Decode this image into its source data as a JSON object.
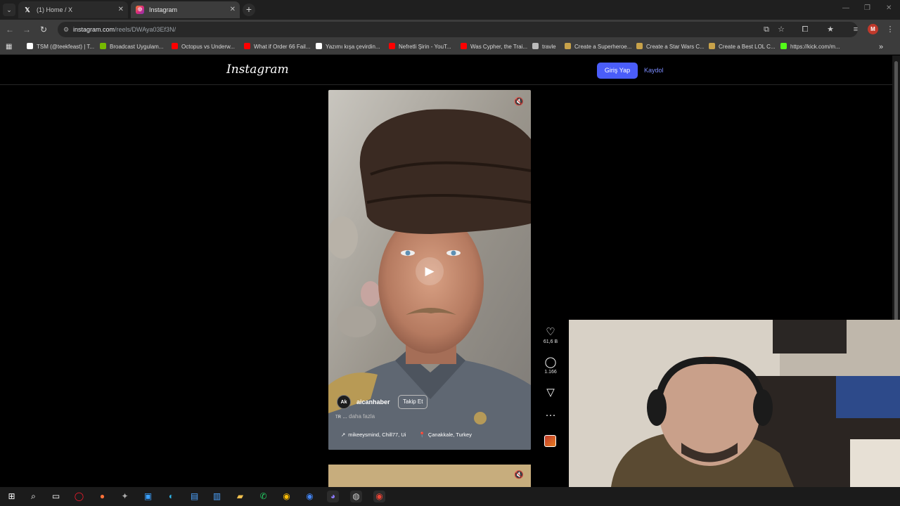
{
  "browser": {
    "tabs": [
      {
        "title": "(1) Home / X",
        "icon": "x-logo-icon",
        "active": false
      },
      {
        "title": "Instagram",
        "icon": "instagram-icon",
        "active": true
      }
    ],
    "url_host": "instagram.com",
    "url_path": "/reels/DWAya03Ef3N/",
    "profile_initial": "M",
    "bookmarks": [
      {
        "label": "TSM (@teekfeast) | T...",
        "icon": "tiktok-icon",
        "color": "#ffffff"
      },
      {
        "label": "Broadcast Uygulam...",
        "icon": "nvidia-icon",
        "color": "#76b900"
      },
      {
        "label": "Octopus vs Underw...",
        "icon": "youtube-icon",
        "color": "#ff0000"
      },
      {
        "label": "What if Order 66 Fail...",
        "icon": "youtube-icon",
        "color": "#ff0000"
      },
      {
        "label": "Yazımı kışa çevirdin...",
        "icon": "tiktok-icon",
        "color": "#ffffff"
      },
      {
        "label": "Nefretli Şirin - YouT...",
        "icon": "youtube-icon",
        "color": "#ff0000"
      },
      {
        "label": "Was Cypher, the Trai...",
        "icon": "youtube-icon",
        "color": "#ff0000"
      },
      {
        "label": "travle",
        "icon": "compass-icon",
        "color": "#bbbbbb"
      },
      {
        "label": "Create a Superheroe...",
        "icon": "page-icon",
        "color": "#c8a24a"
      },
      {
        "label": "Create a Star Wars C...",
        "icon": "page-icon",
        "color": "#c8a24a"
      },
      {
        "label": "Create a Best LOL C...",
        "icon": "page-icon",
        "color": "#c8a24a"
      },
      {
        "label": "https://kick.com/m...",
        "icon": "kick-icon",
        "color": "#53fc18"
      }
    ]
  },
  "instagram": {
    "logo": "Instagram",
    "login_label": "Giriş Yap",
    "signup_label": "Kaydol",
    "reel": {
      "avatar_text": "Ak",
      "username": "aicanhaber",
      "follow_label": "Takip Et",
      "caption_prefix": "ᴛʀ ...",
      "caption_more": "daha fazla",
      "audio": "mikeeysmind, Chill77, Ui",
      "location": "Çanakkale, Turkey",
      "likes": "61,6 B",
      "comments": "1.166"
    }
  },
  "colors": {
    "accent": "#4a5df9",
    "link": "#7b8cff",
    "page_bg": "#000000"
  }
}
